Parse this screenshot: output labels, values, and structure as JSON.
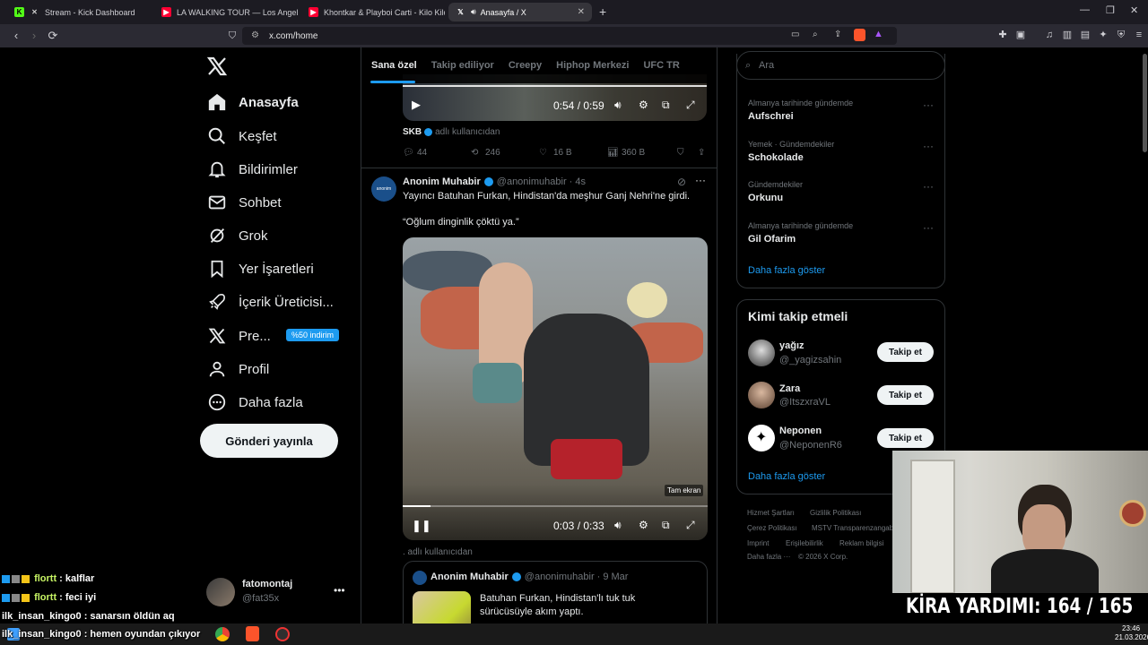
{
  "browser": {
    "tabs": [
      {
        "title": "Stream - Kick Dashboard",
        "icon": "kick-icon",
        "color": "#53fc18"
      },
      {
        "title": "LA WALKING TOUR — Los Angeles, C",
        "icon": "youtube-icon",
        "color": "#ff0033"
      },
      {
        "title": "Khontkar & Playboi Carti - Kilo Kilo M",
        "icon": "youtube-icon",
        "color": "#ff0033"
      },
      {
        "title": "Anasayfa / X",
        "icon": "x-icon",
        "color": "#ffffff"
      }
    ],
    "url": "x.com/home"
  },
  "nav": {
    "items": [
      {
        "label": "Anasayfa",
        "icon": "home-icon"
      },
      {
        "label": "Keşfet",
        "icon": "search-icon"
      },
      {
        "label": "Bildirimler",
        "icon": "bell-icon"
      },
      {
        "label": "Sohbet",
        "icon": "mail-icon"
      },
      {
        "label": "Grok",
        "icon": "grok-icon"
      },
      {
        "label": "Yer İşaretleri",
        "icon": "bookmark-icon"
      },
      {
        "label": "İçerik Üreticisi...",
        "icon": "rocket-icon"
      },
      {
        "label": "Pre...",
        "icon": "x-premium-icon"
      },
      {
        "label": "Profil",
        "icon": "person-icon"
      },
      {
        "label": "Daha fazla",
        "icon": "more-circle-icon"
      }
    ],
    "promo_badge": "%50 indirim",
    "post_button": "Gönderi yayınla",
    "account": {
      "name": "fatomontaj",
      "handle": "@fat35x"
    }
  },
  "feed": {
    "tabs": [
      "Sana özel",
      "Takip ediliyor",
      "Creepy",
      "Hiphop Merkezi",
      "UFC TR"
    ],
    "prev_post": {
      "video_time": "0:54 / 0:59",
      "source_name": "SKB",
      "source_suffix": "adlı kullanıcıdan",
      "replies": "44",
      "reposts": "246",
      "likes": "16 B",
      "views": "360 B"
    },
    "post": {
      "author": "Anonim Muhabir",
      "handle": "@anonimuhabir",
      "age": "· 4s",
      "text": "Yayıncı Batuhan Furkan, Hindistan'da meşhur Ganj Nehri'ne girdi.",
      "quote": "“Oğlum dinginlik çöktü ya.”",
      "video_time": "0:03 / 0:33",
      "video_progress": 0.09,
      "fullscreen_tooltip": "Tam ekran",
      "source_suffix": ". adlı kullanıcıdan"
    },
    "quoted": {
      "author": "Anonim Muhabir",
      "handle": "@anonimuhabir",
      "date": "· 9 Mar",
      "text_line1": "Batuhan Furkan, Hindistan'lı tuk tuk",
      "text_line2": "sürücüsüyle akım yaptı."
    }
  },
  "sidebar": {
    "search_placeholder": "Ara",
    "trends": [
      {
        "context": "Almanya tarihinde gündemde",
        "name": "Aufschrei"
      },
      {
        "context": "Yemek · Gündemdekiler",
        "name": "Schokolade"
      },
      {
        "context": "Gündemdekiler",
        "name": "Orkunu"
      },
      {
        "context": "Almanya tarihinde gündemde",
        "name": "Gil Ofarim"
      }
    ],
    "trends_more": "Daha fazla göster",
    "who_to_follow_title": "Kimi takip etmeli",
    "suggestions": [
      {
        "name": "yağız",
        "handle": "@_yagizsahin",
        "button": "Takip et"
      },
      {
        "name": "Zara",
        "handle": "@ItszxraVL",
        "button": "Takip et"
      },
      {
        "name": "Neponen",
        "handle": "@NeponenR6",
        "button": "Takip et"
      }
    ],
    "follow_more": "Daha fazla göster",
    "footer": [
      "Hizmet Şartları",
      "Gizlilik Politikası",
      "Çerez Politikası",
      "MSTV Transparenzangaben",
      "Imprint",
      "Erişilebilirlik",
      "Reklam bilgisi",
      "Daha fazla ···",
      "© 2026 X Corp."
    ]
  },
  "stream": {
    "chat": [
      {
        "user": "flortt",
        "msg": " : kalflar"
      },
      {
        "user": "flortt",
        "msg": " : feci iyi"
      },
      {
        "user": "ilk_insan_kingo0",
        "msg": " : sanarsın öldün aq"
      },
      {
        "user": "ilk_insan_kingo0",
        "msg": " : hemen oyundan çıkıyor"
      }
    ],
    "rent_label": "KİRA YARDIMI:",
    "rent_value": "164 / 165"
  },
  "taskbar": {
    "time": "23:46",
    "date": "21.03.2026"
  }
}
